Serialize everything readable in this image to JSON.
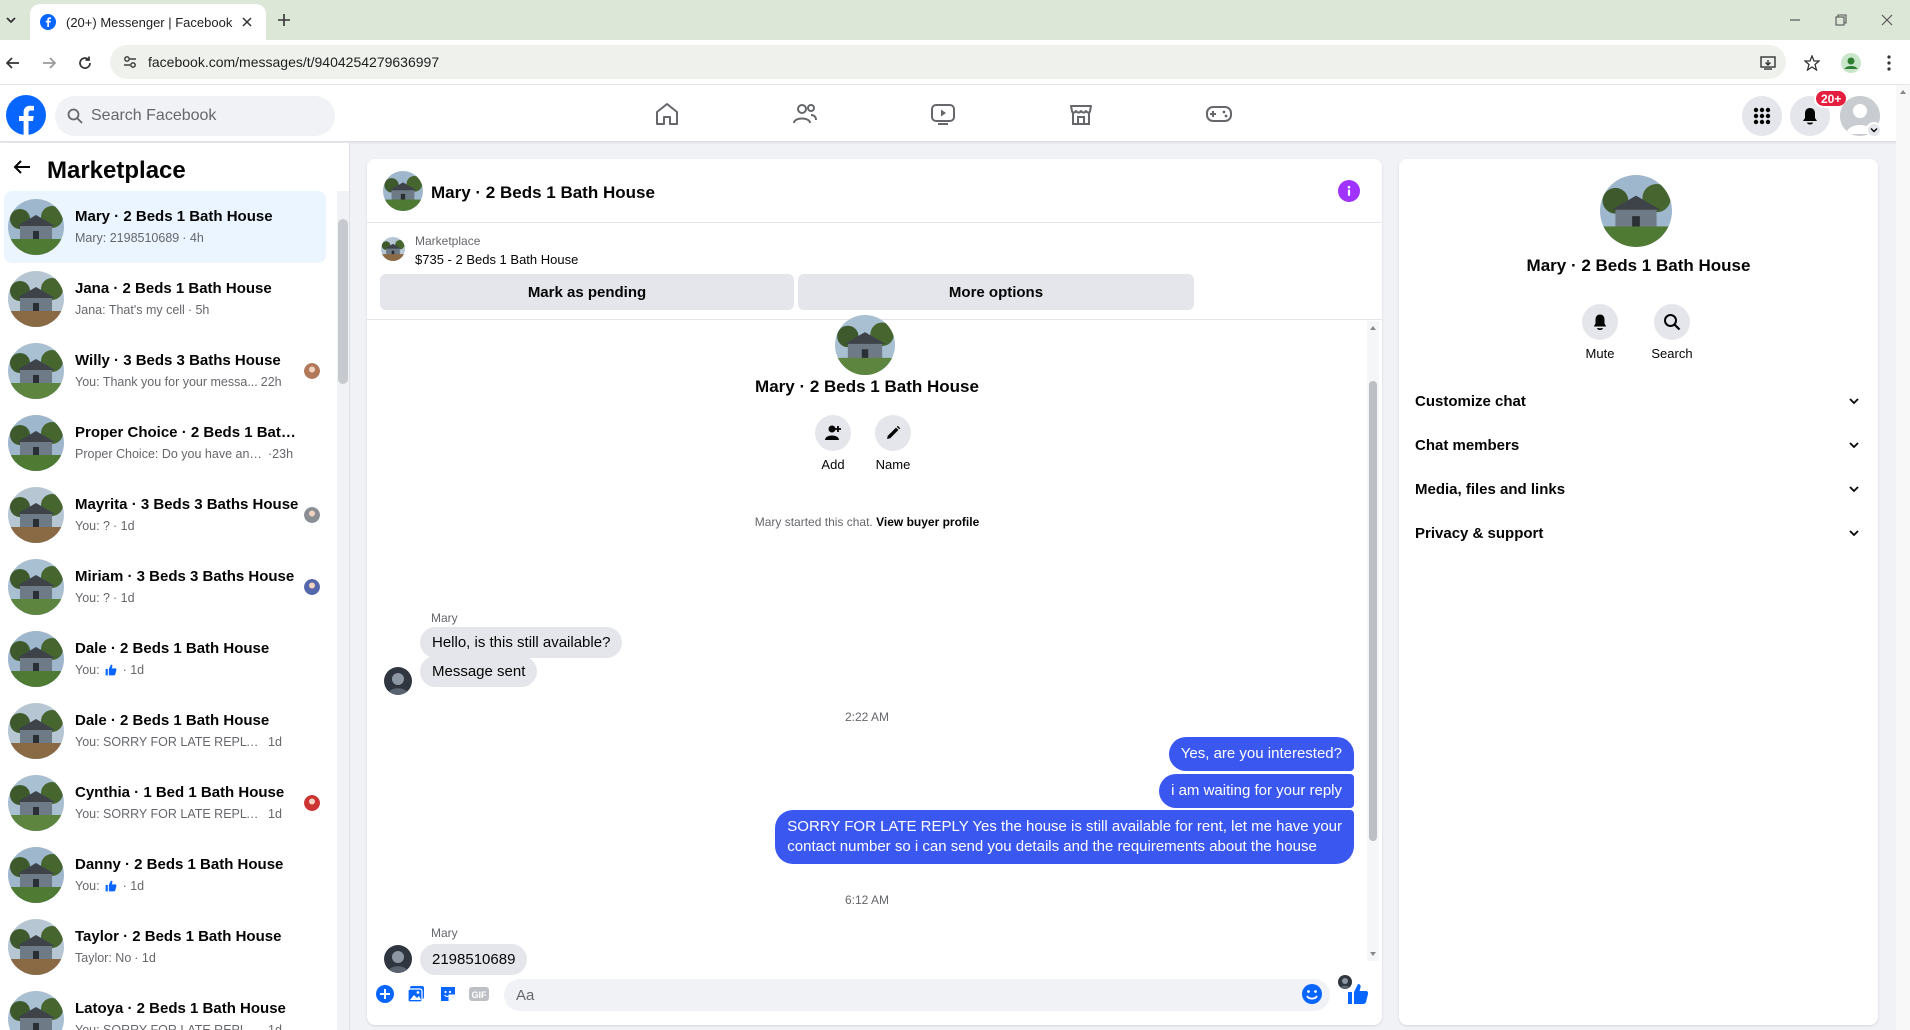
{
  "browser": {
    "tab_title": "(20+) Messenger | Facebook",
    "url": "facebook.com/messages/t/9404254279636997"
  },
  "fb_header": {
    "search_placeholder": "Search Facebook",
    "notification_badge": "20+",
    "nav_items": [
      "home-icon",
      "friends-icon",
      "watch-icon",
      "marketplace-icon",
      "gaming-icon"
    ]
  },
  "sidebar": {
    "title": "Marketplace",
    "conversations": [
      {
        "name": "Mary · 2 Beds 1 Bath House",
        "preview": "Mary: 2198510689",
        "time": "· 4h",
        "active": true
      },
      {
        "name": "Jana · 2 Beds 1 Bath House",
        "preview": "Jana: That's my cell",
        "time": "· 5h"
      },
      {
        "name": "Willy · 3 Beds 3 Baths House",
        "preview": "You: Thank you for your messa...",
        "time": "22h"
      },
      {
        "name": "Proper Choice · 2 Beds 1 Bath H...",
        "preview": "Proper Choice: Do you have anyt...",
        "time": "·23h"
      },
      {
        "name": "Mayrita · 3 Beds 3 Baths House",
        "preview": "You: ?",
        "time": "· 1d"
      },
      {
        "name": "Miriam · 3 Beds 3 Baths House",
        "preview": "You: ?",
        "time": "· 1d"
      },
      {
        "name": "Dale · 2 Beds 1 Bath House",
        "preview": "You:",
        "time": "· 1d"
      },
      {
        "name": "Dale · 2 Beds 1 Bath House",
        "preview": "You: SORRY FOR LATE REPLY Yes th...",
        "time": "1d"
      },
      {
        "name": "Cynthia · 1 Bed 1 Bath House",
        "preview": "You: SORRY FOR LATE REPLY Yes...",
        "time": "1d"
      },
      {
        "name": "Danny · 2 Beds 1 Bath House",
        "preview": "You:",
        "time": "· 1d"
      },
      {
        "name": "Taylor · 2 Beds 1 Bath House",
        "preview": "Taylor: No",
        "time": "· 1d"
      },
      {
        "name": "Latoya · 2 Beds 1 Bath House",
        "preview": "You: SORRY FOR LATE REPLY Yes th...",
        "time": "1d"
      }
    ]
  },
  "chat": {
    "title": "Mary · 2 Beds 1 Bath House",
    "marketplace_label": "Marketplace",
    "listing": "$735 - 2 Beds 1 Bath House",
    "mark_pending": "Mark as pending",
    "more_options": "More options",
    "thread_name": "Mary · 2 Beds 1 Bath House",
    "add_label": "Add",
    "name_label": "Name",
    "started_text": "Mary started this chat.",
    "view_buyer_profile": "View buyer profile",
    "sender_1": "Mary",
    "msg_in_1": "Hello, is this still available?",
    "msg_in_2": "Message sent",
    "time_1": "2:22 AM",
    "msg_out_1": "Yes, are you interested?",
    "msg_out_2": "i am waiting for your reply",
    "msg_out_3_line1": "SORRY FOR LATE REPLY Yes the house is still available for rent, let me have your",
    "msg_out_3_line2": "contact number so i can send you details and the requirements about the house",
    "time_2": "6:12 AM",
    "sender_2": "Mary",
    "msg_in_3": "2198510689",
    "composer_placeholder": "Aa"
  },
  "right_panel": {
    "name": "Mary · 2 Beds 1 Bath House",
    "mute_label": "Mute",
    "search_label": "Search",
    "sections": [
      "Customize chat",
      "Chat members",
      "Media, files and links",
      "Privacy & support"
    ]
  },
  "colors": {
    "fb_blue": "#0866ff",
    "outgoing_bubble": "#3a57f0",
    "info_purple": "#a033ff",
    "badge_red": "#e41e3f"
  }
}
